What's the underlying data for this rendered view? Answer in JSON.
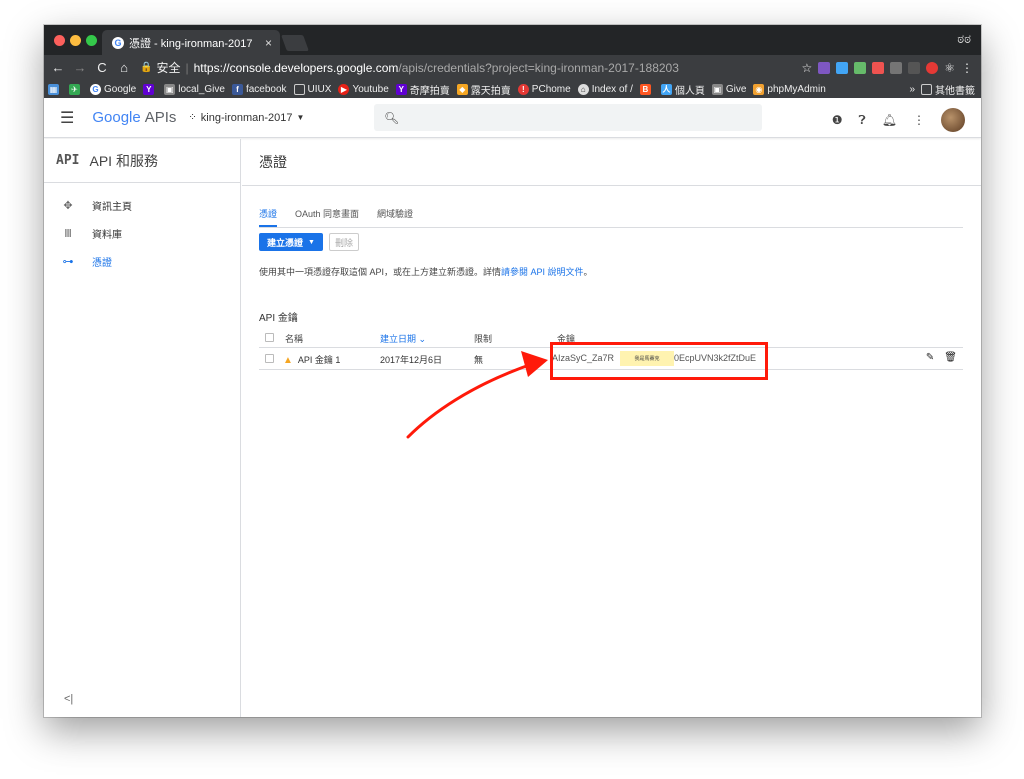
{
  "browser": {
    "tab_title": "憑證 - king-ironman-2017",
    "tab_close": "×",
    "secure_label": "安全",
    "url_host": "https://console.developers.google.com",
    "url_path": "/apis/credentials?project=king-ironman-2017-188203"
  },
  "bookmarks": {
    "items": [
      "Google",
      "local_Give",
      "facebook",
      "UIUX",
      "Youtube",
      "奇摩拍賣",
      "露天拍賣",
      "PChome",
      "Index of /",
      "個人頁",
      "Give",
      "phpMyAdmin"
    ],
    "more": "»",
    "other": "其他書籤"
  },
  "header": {
    "logo": "Google",
    "logo_suffix": "APIs",
    "project": "king-ironman-2017"
  },
  "sidebar": {
    "logo_text": "API",
    "title": "API 和服務",
    "items": [
      {
        "label": "資訊主頁",
        "icon": "dashboard-icon"
      },
      {
        "label": "資料庫",
        "icon": "library-icon"
      },
      {
        "label": "憑證",
        "icon": "key-icon"
      }
    ],
    "collapse": "<|"
  },
  "main": {
    "title": "憑證",
    "tabs": [
      "憑證",
      "OAuth 同意畫面",
      "網域驗證"
    ],
    "create_button": "建立憑證",
    "delete_button": "刪除",
    "description_prefix": "使用其中一項憑證存取這個 API，或在上方建立新憑證。詳情",
    "description_link": "請參閱 API 說明文件",
    "description_suffix": "。",
    "section_title": "API 金鑰",
    "columns": [
      "名稱",
      "建立日期",
      "限制",
      "金鑰"
    ],
    "rows": [
      {
        "name": "API 金鑰 1",
        "date": "2017年12月6日",
        "restriction": "無",
        "key_start": "AIzaSyC_Za7R",
        "key_end": "0EcpUVN3k2fZtDuE",
        "tooltip": "我是馬賽克"
      }
    ]
  },
  "colors": {
    "accent": "#1a73e8",
    "highlight": "#ff1a0a"
  }
}
